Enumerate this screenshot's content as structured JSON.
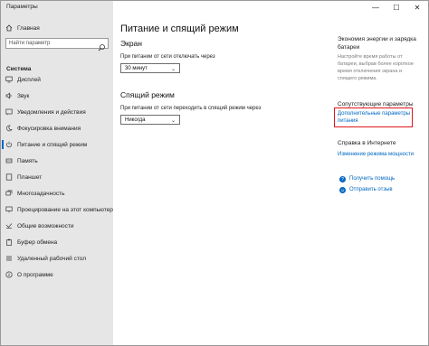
{
  "window": {
    "title": "Параметры",
    "controls": [
      "—",
      "☐",
      "✕"
    ]
  },
  "sidebar": {
    "home": "Главная",
    "search_placeholder": "Найти параметр",
    "section": "Система",
    "items": [
      {
        "label": "Дисплей",
        "icon": "display-icon"
      },
      {
        "label": "Звук",
        "icon": "speaker-icon"
      },
      {
        "label": "Уведомления и действия",
        "icon": "notifications-icon"
      },
      {
        "label": "Фокусировка внимания",
        "icon": "moon-icon"
      },
      {
        "label": "Питание и спящий режим",
        "icon": "power-icon",
        "active": true
      },
      {
        "label": "Память",
        "icon": "storage-icon"
      },
      {
        "label": "Планшет",
        "icon": "tablet-icon"
      },
      {
        "label": "Многозадачность",
        "icon": "multitasking-icon"
      },
      {
        "label": "Проецирование на этот компьютер",
        "icon": "projecting-icon"
      },
      {
        "label": "Общие возможности",
        "icon": "shared-experiences-icon"
      },
      {
        "label": "Буфер обмена",
        "icon": "clipboard-icon"
      },
      {
        "label": "Удаленный рабочий стол",
        "icon": "remote-desktop-icon"
      },
      {
        "label": "О программе",
        "icon": "info-icon"
      }
    ]
  },
  "main": {
    "title": "Питание и спящий режим",
    "screen": {
      "heading": "Экран",
      "label": "При питании от сети отключать через",
      "value": "30 минут"
    },
    "sleep": {
      "heading": "Спящий режим",
      "label": "При питании от сети переходить в спящий режим через",
      "value": "Никогда"
    }
  },
  "right": {
    "battery_heading_1": "Экономия энергии и зарядка",
    "battery_heading_2": "батареи",
    "battery_text": [
      "Настройте время работы от",
      "батареи, выбрав более короткое",
      "время отключения экрана и",
      "спящего режима."
    ],
    "related_heading": "Сопутствующие параметры",
    "related_link_1": "Дополнительные параметры",
    "related_link_2": "питания",
    "help_heading": "Справка в Интернете",
    "help_link": "Изменение режима мощности",
    "get_help": "Получить помощь",
    "feedback": "Отправить отзыв"
  }
}
